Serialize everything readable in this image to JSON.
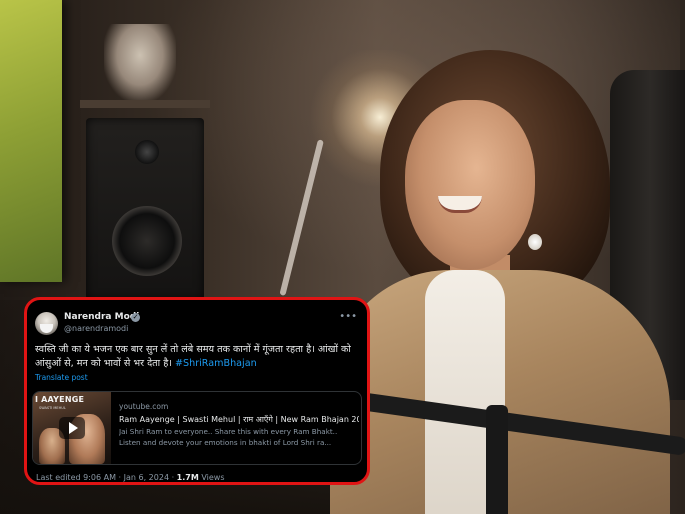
{
  "tweet": {
    "display_name": "Narendra Modi",
    "handle": "@narendramodi",
    "more_icon": "more-horizontal-icon",
    "verified_icon": "verified-badge-icon",
    "text_line1": "स्वस्ति जी का ये भजन एक बार सुन लें तो लंबे समय तक कानों में गूंजता रहता है। आंखों को",
    "text_line2": "आंसुओं से, मन को भावों से भर देता है।",
    "hashtag": "#ShriRamBhajan",
    "translate": "Translate post",
    "link_card": {
      "thumb_title": "I AAYENGE",
      "thumb_subtitle": "SWASTI MEHUL",
      "play_icon": "play-icon",
      "domain": "youtube.com",
      "title": "Ram Aayenge | Swasti Mehul | राम आएँगे | New Ram Bhajan 20",
      "desc_line1": "Jai Shri Ram to everyone.. Share this with every Ram Bhakt..",
      "desc_line2": "Listen and devote your emotions in bhakti of Lord Shri ra..."
    },
    "footer": {
      "edited": "Last edited 9:06 AM · Jan 6, 2024 · ",
      "views_count": "1.7M",
      "views_label": " Views"
    }
  },
  "colors": {
    "border": "#e01414",
    "link": "#1d9bf0",
    "muted": "#8b98a5",
    "text": "#e7e9ea",
    "card_bg": "#000000"
  }
}
